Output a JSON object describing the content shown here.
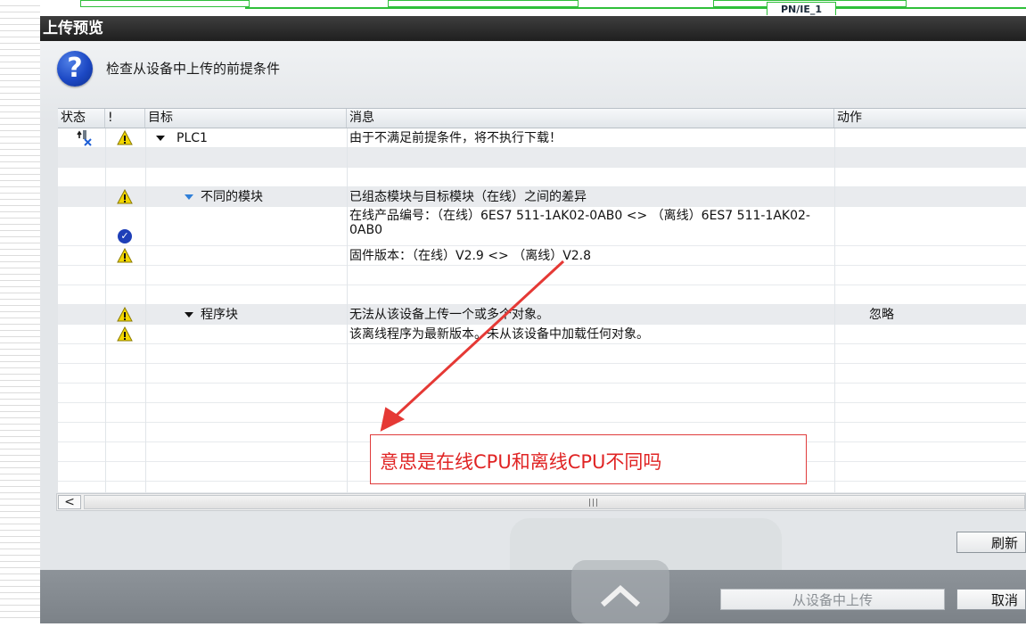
{
  "background": {
    "network_label": "PN/IE_1"
  },
  "dialog": {
    "title": "上传预览",
    "heading": "检查从设备中上传的前提条件"
  },
  "table": {
    "columns": {
      "status": "状态",
      "alert": "!",
      "target": "目标",
      "message": "消息",
      "action": "动作"
    },
    "rows": [
      {
        "target": "PLC1",
        "message": "由于不满足前提条件，将不执行下载！",
        "action": ""
      },
      {
        "target": "",
        "message": "",
        "action": ""
      },
      {
        "target": "不同的模块",
        "message": "已组态模块与目标模块（在线）之间的差异",
        "action": ""
      },
      {
        "target": "",
        "message": "在线产品编号：（在线）6ES7 511-1AK02-0AB0 <> （离线）6ES7 511-1AK02-0AB0",
        "action": ""
      },
      {
        "target": "",
        "message": "固件版本：（在线）V2.9 <> （离线）V2.8",
        "action": ""
      },
      {
        "target": "",
        "message": "",
        "action": ""
      },
      {
        "target": "程序块",
        "message": "无法从该设备上传一个或多个对象。",
        "action": "忽略"
      },
      {
        "target": "",
        "message": "该离线程序为最新版本。未从该设备中加载任何对象。",
        "action": ""
      }
    ]
  },
  "scrollbar": {
    "left_arrow": "<",
    "grip": "|||"
  },
  "buttons": {
    "refresh": "刷新",
    "upload": "从设备中上传",
    "cancel": "取消"
  },
  "annotation": {
    "text": "意思是在线CPU和离线CPU不同吗",
    "color": "#e02424"
  },
  "colors": {
    "warning": "#f2d600",
    "titlebar": "#2b2b2b",
    "accent_blue": "#1e3fb8"
  }
}
